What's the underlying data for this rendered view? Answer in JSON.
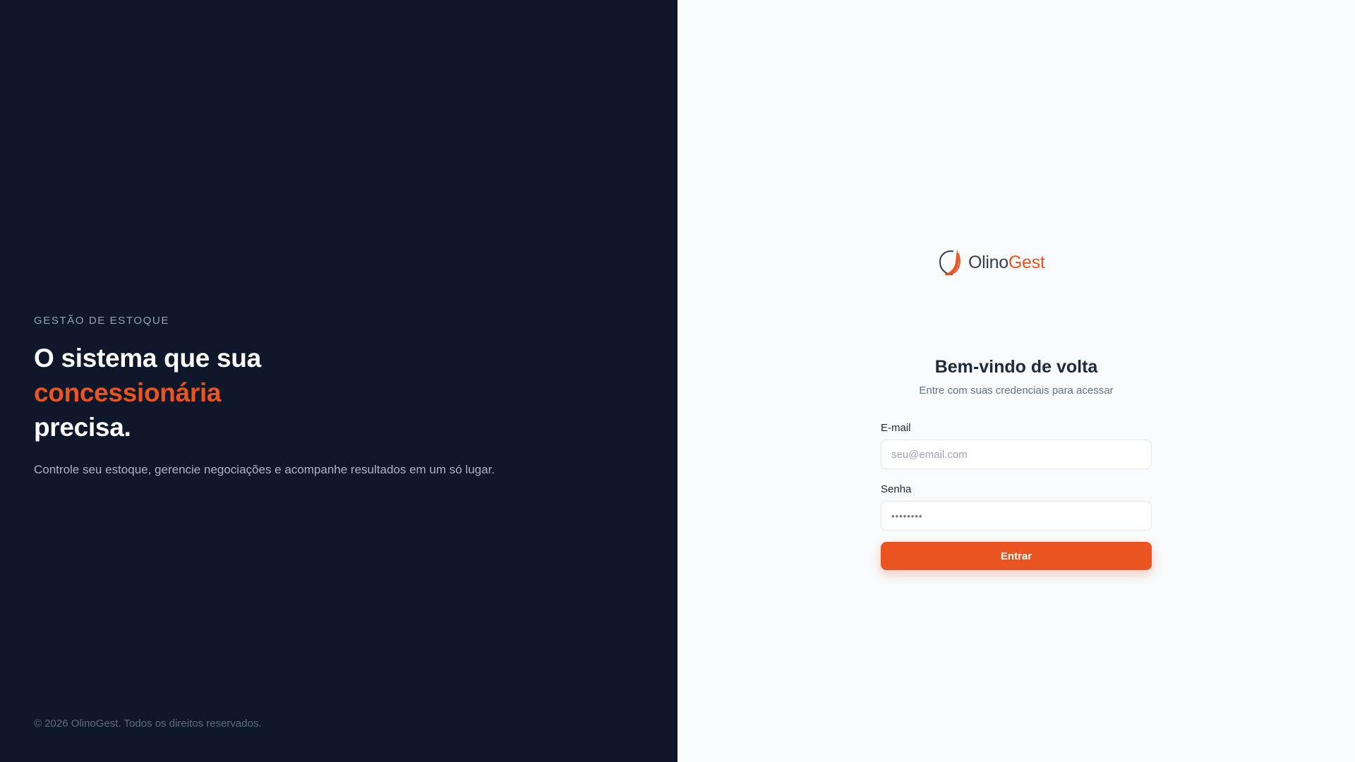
{
  "hero": {
    "eyebrow": "GESTÃO DE ESTOQUE",
    "headline_line1": "O sistema que sua",
    "headline_accent": "concessionária",
    "headline_line3": "precisa.",
    "subtitle": "Controle seu estoque, gerencie negociações e acompanhe resultados em um só lugar.",
    "footer": "© 2026 OlinoGest. Todos os direitos reservados."
  },
  "brand": {
    "name_part1": "Olino",
    "name_part2": "Gest",
    "accent_color": "#ea5420",
    "dark_color": "#0f172a",
    "logo_icon": "crescent-logo-icon"
  },
  "login": {
    "title": "Bem-vindo de volta",
    "subtitle": "Entre com suas credenciais para acessar",
    "email_label": "E-mail",
    "email_placeholder": "seu@email.com",
    "email_value": "",
    "password_label": "Senha",
    "password_placeholder": "••••••••",
    "submit_label": "Entrar"
  }
}
